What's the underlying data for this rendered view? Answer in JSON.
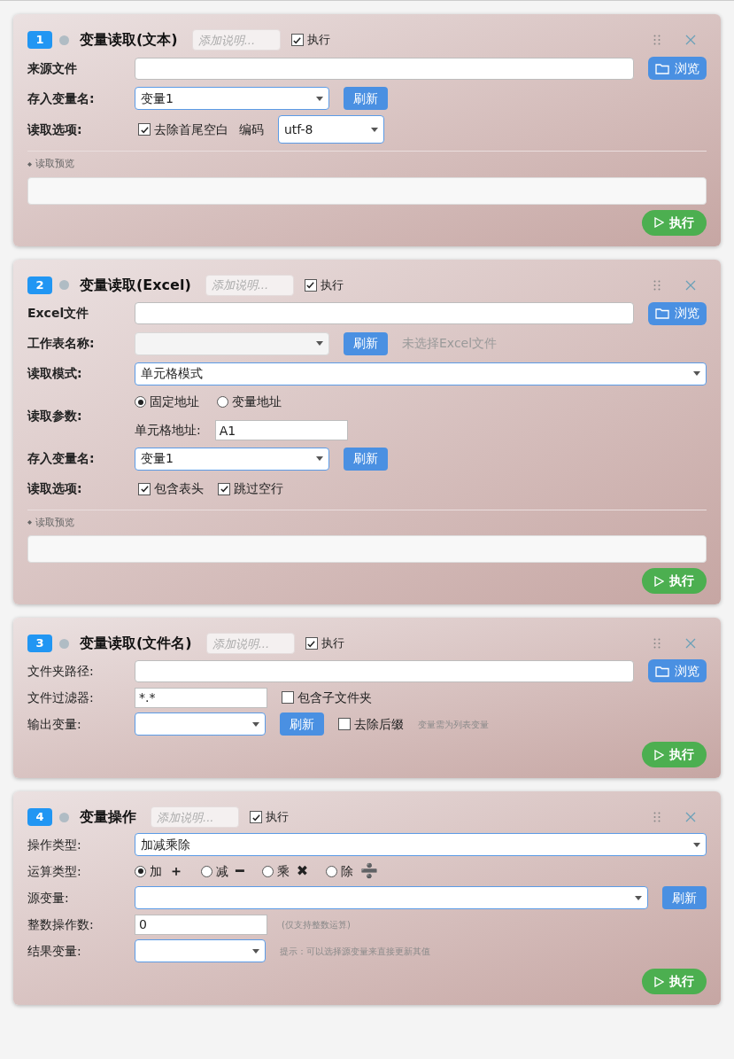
{
  "cards": [
    {
      "number": "1",
      "title": "变量读取(文本)",
      "note": {
        "placeholder": "添加说明..."
      },
      "enabled": {
        "label": "执行",
        "checked": true
      },
      "bold_labels": true,
      "rows": [
        {
          "label": "来源文件",
          "items": [
            {
              "kind": "path_field"
            },
            {
              "kind": "browse_button",
              "label": "浏览"
            }
          ]
        },
        {
          "label": "存入变量名:",
          "items": [
            {
              "kind": "select",
              "value": "变量1",
              "disabled": false
            },
            {
              "kind": "refresh_button",
              "label": "刷新"
            }
          ]
        },
        {
          "label": "读取选项:",
          "items": [
            {
              "kind": "checkbox",
              "label": "去除首尾空白",
              "checked": true
            },
            {
              "kind": "text",
              "text": "编码"
            },
            {
              "kind": "select_small",
              "value": "utf-8",
              "disabled": false
            }
          ]
        }
      ],
      "preview": {
        "label": "读取预览"
      },
      "run_label": "执行"
    },
    {
      "number": "2",
      "title": "变量读取(Excel)",
      "note": {
        "placeholder": "添加说明..."
      },
      "enabled": {
        "label": "执行",
        "checked": true
      },
      "bold_labels": true,
      "rows": [
        {
          "label": "Excel文件",
          "items": [
            {
              "kind": "path_field"
            },
            {
              "kind": "browse_button",
              "label": "浏览"
            }
          ]
        },
        {
          "label": "工作表名称:",
          "items": [
            {
              "kind": "select",
              "disabled": true
            },
            {
              "kind": "refresh_button",
              "label": "刷新"
            },
            {
              "kind": "status",
              "text": "未选择Excel文件"
            }
          ]
        },
        {
          "label": "读取模式:",
          "items": [
            {
              "kind": "select_full",
              "value": "单元格模式",
              "disabled": false
            }
          ]
        },
        {
          "label": "读取参数:",
          "lines": [
            {
              "items": [
                {
                  "kind": "radio",
                  "label": "固定地址",
                  "selected": true
                },
                {
                  "kind": "radio",
                  "label": "变量地址",
                  "selected": false
                }
              ]
            },
            {
              "items": [
                {
                  "kind": "text",
                  "text": "单元格地址:"
                },
                {
                  "kind": "short_field",
                  "value": "A1"
                }
              ]
            }
          ]
        },
        {
          "label": "存入变量名:",
          "items": [
            {
              "kind": "select",
              "value": "变量1",
              "disabled": false
            },
            {
              "kind": "refresh_button",
              "label": "刷新"
            }
          ]
        },
        {
          "label": "读取选项:",
          "items": [
            {
              "kind": "checkbox",
              "label": "包含表头",
              "checked": true
            },
            {
              "kind": "checkbox",
              "label": "跳过空行",
              "checked": true
            }
          ]
        }
      ],
      "preview": {
        "label": "读取预览"
      },
      "run_label": "执行"
    },
    {
      "number": "3",
      "title": "变量读取(文件名)",
      "note": {
        "placeholder": "添加说明..."
      },
      "enabled": {
        "label": "执行",
        "checked": true
      },
      "bold_labels": false,
      "rows": [
        {
          "label": "文件夹路径:",
          "items": [
            {
              "kind": "path_field"
            },
            {
              "kind": "browse_button",
              "label": "浏览"
            }
          ]
        },
        {
          "label": "文件过滤器:",
          "items": [
            {
              "kind": "short_field",
              "value": "*.*"
            },
            {
              "kind": "checkbox",
              "label": "包含子文件夹",
              "checked": false
            }
          ]
        },
        {
          "label": "输出变量:",
          "items": [
            {
              "kind": "select_medium",
              "disabled": false
            },
            {
              "kind": "refresh_button",
              "label": "刷新"
            },
            {
              "kind": "checkbox",
              "label": "去除后缀",
              "checked": false
            },
            {
              "kind": "hint",
              "text": "变量需为列表变量"
            }
          ]
        }
      ],
      "run_label": "执行"
    },
    {
      "number": "4",
      "title": "变量操作",
      "note": {
        "placeholder": "添加说明..."
      },
      "enabled": {
        "label": "执行",
        "checked": true
      },
      "bold_labels": false,
      "rows": [
        {
          "label": "操作类型:",
          "items": [
            {
              "kind": "select_full",
              "value": "加减乘除",
              "disabled": false
            }
          ]
        },
        {
          "label": "运算类型:",
          "items": [
            {
              "kind": "radio",
              "label": "加",
              "symbol": "＋",
              "selected": true
            },
            {
              "kind": "radio",
              "label": "减",
              "symbol": "━",
              "selected": false
            },
            {
              "kind": "radio",
              "label": "乘",
              "symbol": "✖",
              "selected": false
            },
            {
              "kind": "radio",
              "label": "除",
              "symbol": "➗",
              "selected": false
            }
          ]
        },
        {
          "label": "源变量:",
          "items": [
            {
              "kind": "select_full",
              "disabled": false
            },
            {
              "kind": "refresh_button",
              "label": "刷新"
            }
          ]
        },
        {
          "label": "整数操作数:",
          "items": [
            {
              "kind": "short_field",
              "value": "0"
            },
            {
              "kind": "hint",
              "text": "(仅支持整数运算)"
            }
          ]
        },
        {
          "label": "结果变量:",
          "items": [
            {
              "kind": "select_medium",
              "disabled": false
            },
            {
              "kind": "hint",
              "text": "提示：可以选择源变量来直接更新其值"
            }
          ]
        }
      ],
      "run_label": "执行"
    }
  ]
}
